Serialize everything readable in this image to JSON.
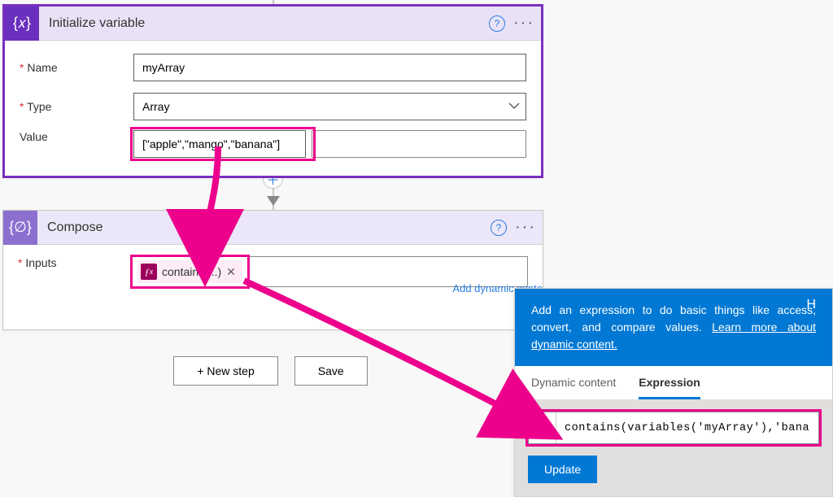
{
  "init": {
    "title": "Initialize variable",
    "name_label": "Name",
    "name_value": "myArray",
    "type_label": "Type",
    "type_value": "Array",
    "value_label": "Value",
    "value_value": "[\"apple\",\"mango\",\"banana\"]"
  },
  "compose": {
    "title": "Compose",
    "inputs_label": "Inputs",
    "token_label": "contains(...)",
    "dynamic_link": "Add dynamic conte"
  },
  "buttons": {
    "new_step": "+ New step",
    "save": "Save"
  },
  "panel": {
    "hint_pre": "Add an expression to do basic things like access, convert, and compare values. ",
    "hint_link": "Learn more about dynamic content.",
    "tab_dynamic": "Dynamic content",
    "tab_expr": "Expression",
    "expr_value": "contains(variables('myArray'),'banana')",
    "update": "Update"
  }
}
